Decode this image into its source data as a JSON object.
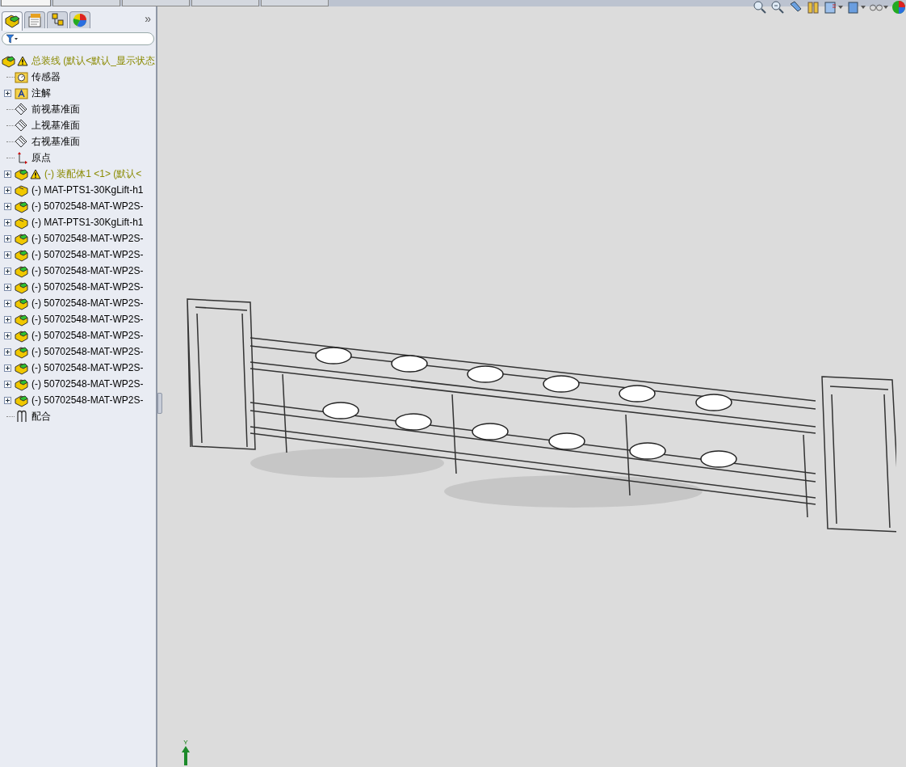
{
  "command_tabs": [
    {
      "selected": true
    },
    {
      "selected": false
    },
    {
      "selected": false
    },
    {
      "selected": false
    },
    {
      "selected": false
    }
  ],
  "panel_tabs": [
    {
      "kind": "tree",
      "selected": true
    },
    {
      "kind": "property",
      "selected": false
    },
    {
      "kind": "config",
      "selected": false
    },
    {
      "kind": "appearance",
      "selected": false
    }
  ],
  "panel_more": "»",
  "tree": [
    {
      "label": "总装线  (默认<默认_显示状态",
      "kind": "assembly",
      "warning": true,
      "children": [
        {
          "label": "传感器",
          "kind": "sensor-folder",
          "warning": false,
          "expandable": false
        },
        {
          "label": "注解",
          "kind": "annotation-folder",
          "warning": false,
          "expandable": true,
          "expanded": false
        },
        {
          "label": "前视基准面",
          "kind": "plane",
          "warning": false,
          "expandable": false
        },
        {
          "label": "上视基准面",
          "kind": "plane",
          "warning": false,
          "expandable": false
        },
        {
          "label": "右视基准面",
          "kind": "plane",
          "warning": false,
          "expandable": false
        },
        {
          "label": "原点",
          "kind": "origin",
          "warning": false,
          "expandable": false
        },
        {
          "label": "(-) 装配体1 <1> (默认<",
          "kind": "assembly",
          "warning": true,
          "expandable": true,
          "expanded": false
        },
        {
          "label": "(-) MAT-PTS1-30KgLift-h1",
          "kind": "part",
          "warning": false,
          "expandable": true,
          "expanded": false
        },
        {
          "label": "(-) 50702548-MAT-WP2S-",
          "kind": "assembly",
          "warning": false,
          "expandable": true,
          "expanded": false
        },
        {
          "label": "(-) MAT-PTS1-30KgLift-h1",
          "kind": "part",
          "warning": false,
          "expandable": true,
          "expanded": false
        },
        {
          "label": "(-) 50702548-MAT-WP2S-",
          "kind": "assembly",
          "warning": false,
          "expandable": true,
          "expanded": false
        },
        {
          "label": "(-) 50702548-MAT-WP2S-",
          "kind": "assembly",
          "warning": false,
          "expandable": true,
          "expanded": false
        },
        {
          "label": "(-) 50702548-MAT-WP2S-",
          "kind": "assembly",
          "warning": false,
          "expandable": true,
          "expanded": false
        },
        {
          "label": "(-) 50702548-MAT-WP2S-",
          "kind": "assembly",
          "warning": false,
          "expandable": true,
          "expanded": false
        },
        {
          "label": "(-) 50702548-MAT-WP2S-",
          "kind": "assembly",
          "warning": false,
          "expandable": true,
          "expanded": false
        },
        {
          "label": "(-) 50702548-MAT-WP2S-",
          "kind": "assembly",
          "warning": false,
          "expandable": true,
          "expanded": false
        },
        {
          "label": "(-) 50702548-MAT-WP2S-",
          "kind": "assembly",
          "warning": false,
          "expandable": true,
          "expanded": false
        },
        {
          "label": "(-) 50702548-MAT-WP2S-",
          "kind": "assembly",
          "warning": false,
          "expandable": true,
          "expanded": false
        },
        {
          "label": "(-) 50702548-MAT-WP2S-",
          "kind": "assembly",
          "warning": false,
          "expandable": true,
          "expanded": false
        },
        {
          "label": "(-) 50702548-MAT-WP2S-",
          "kind": "assembly",
          "warning": false,
          "expandable": true,
          "expanded": false
        },
        {
          "label": "(-) 50702548-MAT-WP2S-",
          "kind": "assembly",
          "warning": false,
          "expandable": true,
          "expanded": false
        },
        {
          "label": "配合",
          "kind": "mates",
          "warning": false,
          "expandable": false
        }
      ]
    }
  ],
  "triad_label": "Y"
}
